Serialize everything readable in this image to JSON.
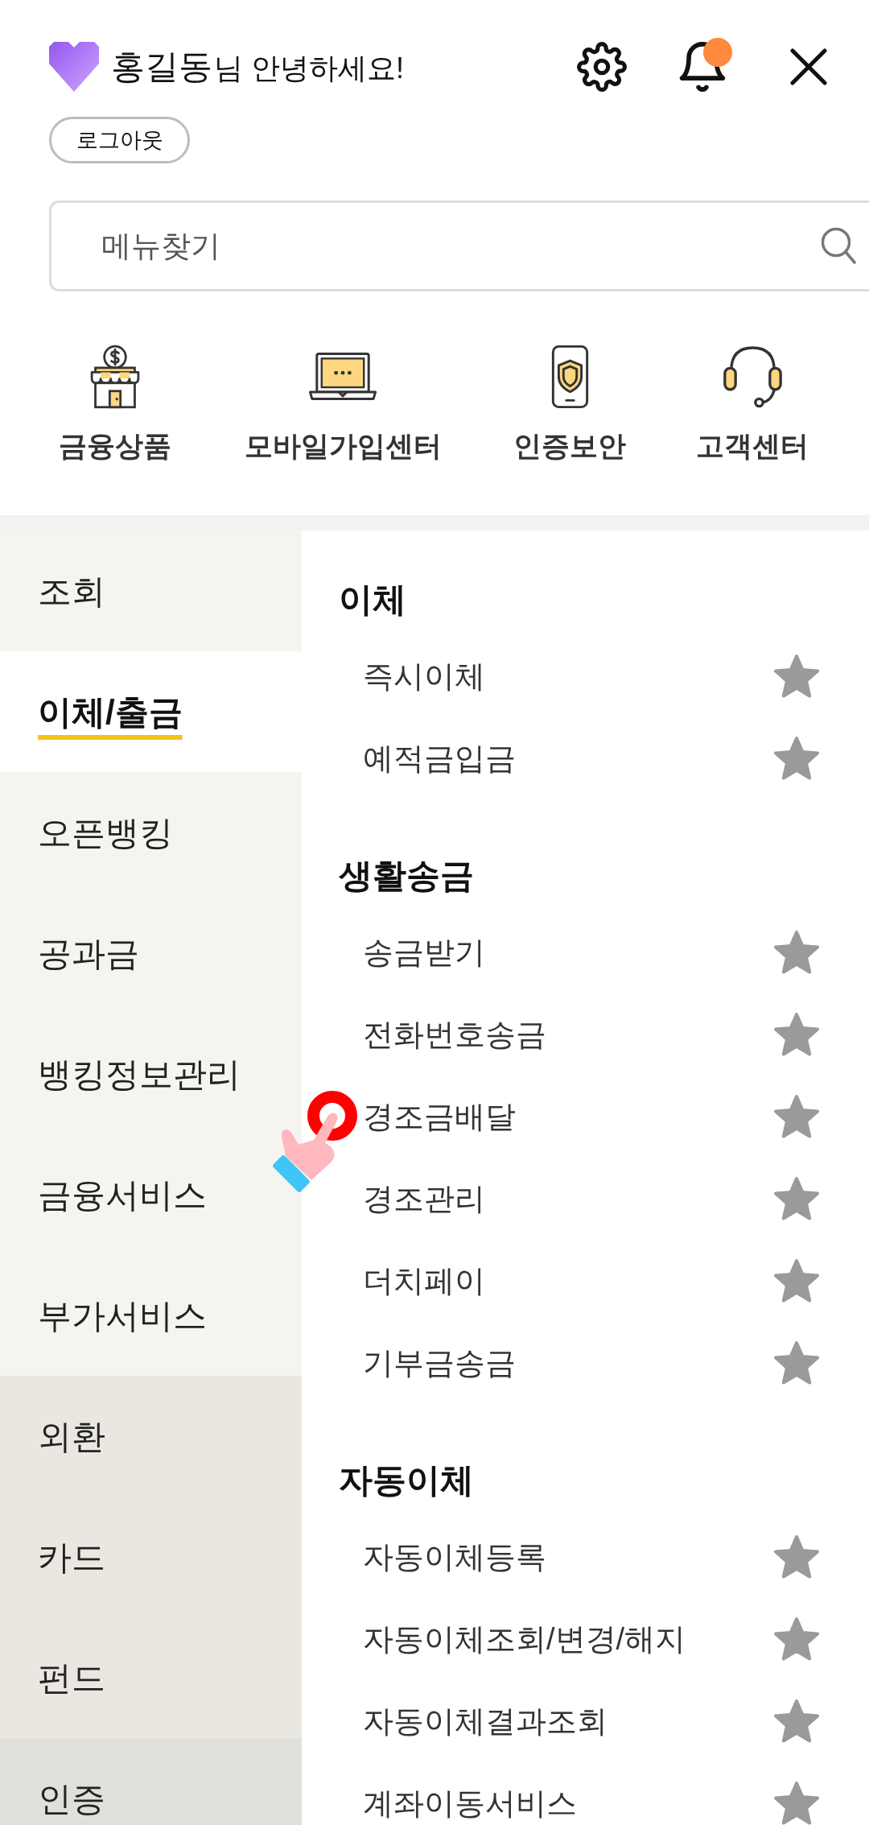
{
  "header": {
    "user_name": "홍길동",
    "greeting": "님 안녕하세요!",
    "notification_badge": true,
    "logout_button": "로그아웃"
  },
  "search": {
    "placeholder": "메뉴찾기"
  },
  "quick_links": [
    {
      "label": "금융상품"
    },
    {
      "label": "모바일가입센터"
    },
    {
      "label": "인증보안"
    },
    {
      "label": "고객센터"
    }
  ],
  "sidebar": {
    "sections": [
      {
        "items": [
          {
            "label": "조회",
            "selected": false
          },
          {
            "label": "이체/출금",
            "selected": true
          },
          {
            "label": "오픈뱅킹",
            "selected": false
          },
          {
            "label": "공과금",
            "selected": false
          },
          {
            "label": "뱅킹정보관리",
            "selected": false
          },
          {
            "label": "금융서비스",
            "selected": false
          },
          {
            "label": "부가서비스",
            "selected": false
          }
        ]
      },
      {
        "items": [
          {
            "label": "외환",
            "selected": false
          },
          {
            "label": "카드",
            "selected": false
          },
          {
            "label": "펀드",
            "selected": false
          }
        ]
      },
      {
        "items": [
          {
            "label": "인증",
            "selected": false
          }
        ]
      }
    ]
  },
  "menu": {
    "sections": [
      {
        "title": "이체",
        "items": [
          {
            "label": "즉시이체",
            "favorite": false
          },
          {
            "label": "예적금입금",
            "favorite": false
          }
        ]
      },
      {
        "title": "생활송금",
        "items": [
          {
            "label": "송금받기",
            "favorite": false
          },
          {
            "label": "전화번호송금",
            "favorite": false
          },
          {
            "label": "경조금배달",
            "favorite": false
          },
          {
            "label": "경조관리",
            "favorite": false
          },
          {
            "label": "더치페이",
            "favorite": false
          },
          {
            "label": "기부금송금",
            "favorite": false
          }
        ]
      },
      {
        "title": "자동이체",
        "items": [
          {
            "label": "자동이체등록",
            "favorite": false
          },
          {
            "label": "자동이체조회/변경/해지",
            "favorite": false
          },
          {
            "label": "자동이체결과조회",
            "favorite": false
          },
          {
            "label": "계좌이동서비스",
            "favorite": false
          }
        ]
      }
    ]
  }
}
